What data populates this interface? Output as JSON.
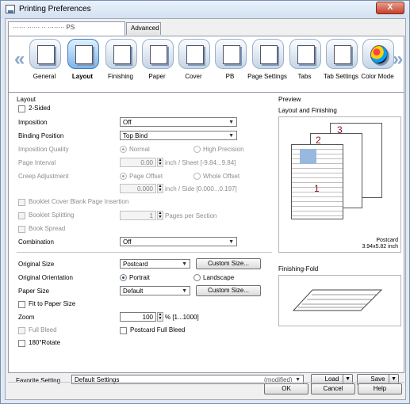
{
  "window": {
    "title": "Printing Preferences",
    "close_label": "X"
  },
  "tabs": [
    {
      "label": "······ ······ ·· ········ PS"
    },
    {
      "label": "Advanced"
    }
  ],
  "toolbar": {
    "items": [
      {
        "label": "General",
        "icon": "general-icon"
      },
      {
        "label": "Layout",
        "icon": "layout-icon",
        "selected": true
      },
      {
        "label": "Finishing",
        "icon": "finishing-icon"
      },
      {
        "label": "Paper",
        "icon": "paper-icon"
      },
      {
        "label": "Cover",
        "icon": "cover-icon"
      },
      {
        "label": "PB",
        "icon": "pb-icon"
      },
      {
        "label": "Page Settings",
        "icon": "page-settings-icon"
      },
      {
        "label": "Tabs",
        "icon": "tabs-icon"
      },
      {
        "label": "Tab Settings",
        "icon": "tab-settings-icon"
      },
      {
        "label": "Color Mode",
        "icon": "color-mode-icon"
      }
    ],
    "left_arrow": "«",
    "right_arrow": "»"
  },
  "layout": {
    "section_title": "Layout",
    "two_sided": "2-Sided",
    "imposition_label": "Imposition",
    "imposition_value": "Off",
    "binding_label": "Binding Position",
    "binding_value": "Top Bind",
    "imposition_quality_label": "Imposition Quality",
    "quality_normal": "Normal",
    "quality_high": "High Precision",
    "page_interval_label": "Page Interval",
    "page_interval_value": "0.00",
    "page_interval_unit": "inch / Sheet [-9.84...9.84]",
    "creep_label": "Creep Adjustment",
    "creep_page_offset": "Page Offset",
    "creep_whole_offset": "Whole Offset",
    "creep_value": "0.000",
    "creep_unit": "inch / Side [0.000...0.197]",
    "booklet_cover": "Booklet Cover Blank Page Insertion",
    "booklet_splitting": "Booklet Splitting",
    "booklet_split_value": "1",
    "booklet_split_unit": "Pages per Section",
    "book_spread": "Book Spread",
    "combination_label": "Combination",
    "combination_value": "Off",
    "original_size_label": "Original Size",
    "original_size_value": "Postcard",
    "custom_size_1": "Custom Size...",
    "orientation_label": "Original Orientation",
    "portrait": "Portrait",
    "landscape": "Landscape",
    "paper_size_label": "Paper Size",
    "paper_size_value": "Default",
    "custom_size_2": "Custom Size...",
    "fit_to_paper": "Fit to Paper Size",
    "zoom_label": "Zoom",
    "zoom_value": "100",
    "zoom_unit": "% [1...1000]",
    "full_bleed": "Full Bleed",
    "postcard_full_bleed": "Postcard Full Bleed",
    "rotate": "180°Rotate"
  },
  "preview": {
    "section_title": "Preview",
    "layout_finishing": "Layout and Finishing",
    "page_numbers": [
      "1",
      "2",
      "3"
    ],
    "paper_name": "Postcard",
    "paper_dims": "3.94x5.82 inch",
    "finishing_fold": "Finishing-Fold"
  },
  "footer": {
    "favorite_label": "Favorite Setting",
    "favorite_value": "Default Settings",
    "favorite_status": "(modified)",
    "load": "Load",
    "save": "Save",
    "ok": "OK",
    "cancel": "Cancel",
    "help": "Help"
  }
}
